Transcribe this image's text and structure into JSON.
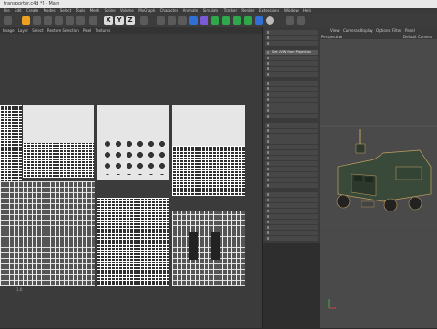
{
  "title": "transporter.c4d *] - Main",
  "menu": [
    "File",
    "Edit",
    "Create",
    "Modes",
    "Select",
    "Tools",
    "Mesh",
    "Spline",
    "Volume",
    "MoGraph",
    "Character",
    "Animate",
    "Simulate",
    "Tracker",
    "Render",
    "Extensions",
    "Window",
    "Help"
  ],
  "axes": [
    "X",
    "Y",
    "Z"
  ],
  "uv_menu": [
    "Image",
    "Layer",
    "Select",
    "Restore Selection",
    "Pixel",
    "Textures"
  ],
  "uv_corner_label": "1,0",
  "object_panel": {
    "items": [
      "",
      "",
      "",
      "Set UVW from Projection",
      "",
      "",
      "",
      "",
      "",
      "",
      "",
      "",
      "",
      "",
      "",
      "",
      "",
      "",
      "",
      "",
      "",
      "",
      "",
      "",
      "",
      "",
      "",
      "",
      "",
      "",
      "",
      "",
      "",
      "",
      "",
      "",
      "",
      "",
      "",
      ""
    ]
  },
  "viewport": {
    "label": "Perspective",
    "camera": "Default Camera",
    "menu": [
      "View",
      "Cameras",
      "Display",
      "Options",
      "Filter",
      "Panel"
    ]
  },
  "colors": {
    "accent": "#f0a020",
    "bg": "#2b2b2b"
  }
}
